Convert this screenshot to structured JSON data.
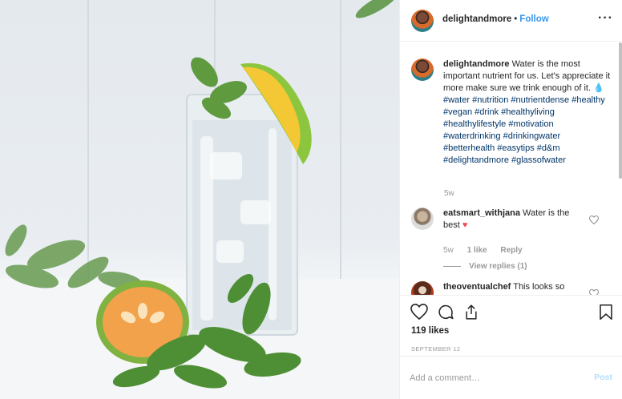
{
  "header": {
    "username": "delightandmore",
    "separator": "•",
    "follow_label": "Follow",
    "more_label": "···"
  },
  "caption": {
    "username": "delightandmore",
    "text": "Water is the most important nutrient for us. Let's appreciate it more make sure we trink enough of it.",
    "emoji": "💧",
    "hashtags": "#water #nutrition #nutrientdense #healthy #vegan #drink #healthyliving #healthylifestyle #motivation #waterdrinking #drinkingwater #betterhealth #easytips #d&m #delightandmore #glassofwater",
    "time": "5w"
  },
  "comments": [
    {
      "username": "eatsmart_withjana",
      "text": "Water is the best",
      "emoji": "❤️",
      "time": "5w",
      "likes": "1 like",
      "reply_label": "Reply",
      "view_replies": "View replies (1)"
    },
    {
      "username": "theoventualchef",
      "text": "This looks so"
    }
  ],
  "actions": {
    "likes": "119 likes",
    "date": "SEPTEMBER 12",
    "icons": [
      "heart-outline",
      "comment-bubble",
      "share-upload",
      "bookmark"
    ]
  },
  "add_comment": {
    "placeholder": "Add a comment…",
    "post_label": "Post"
  },
  "colors": {
    "link": "#3897f0",
    "hashtag": "#003569",
    "muted": "#999999",
    "post_disabled": "#b2dffc",
    "heart_red": "#ed4956"
  }
}
